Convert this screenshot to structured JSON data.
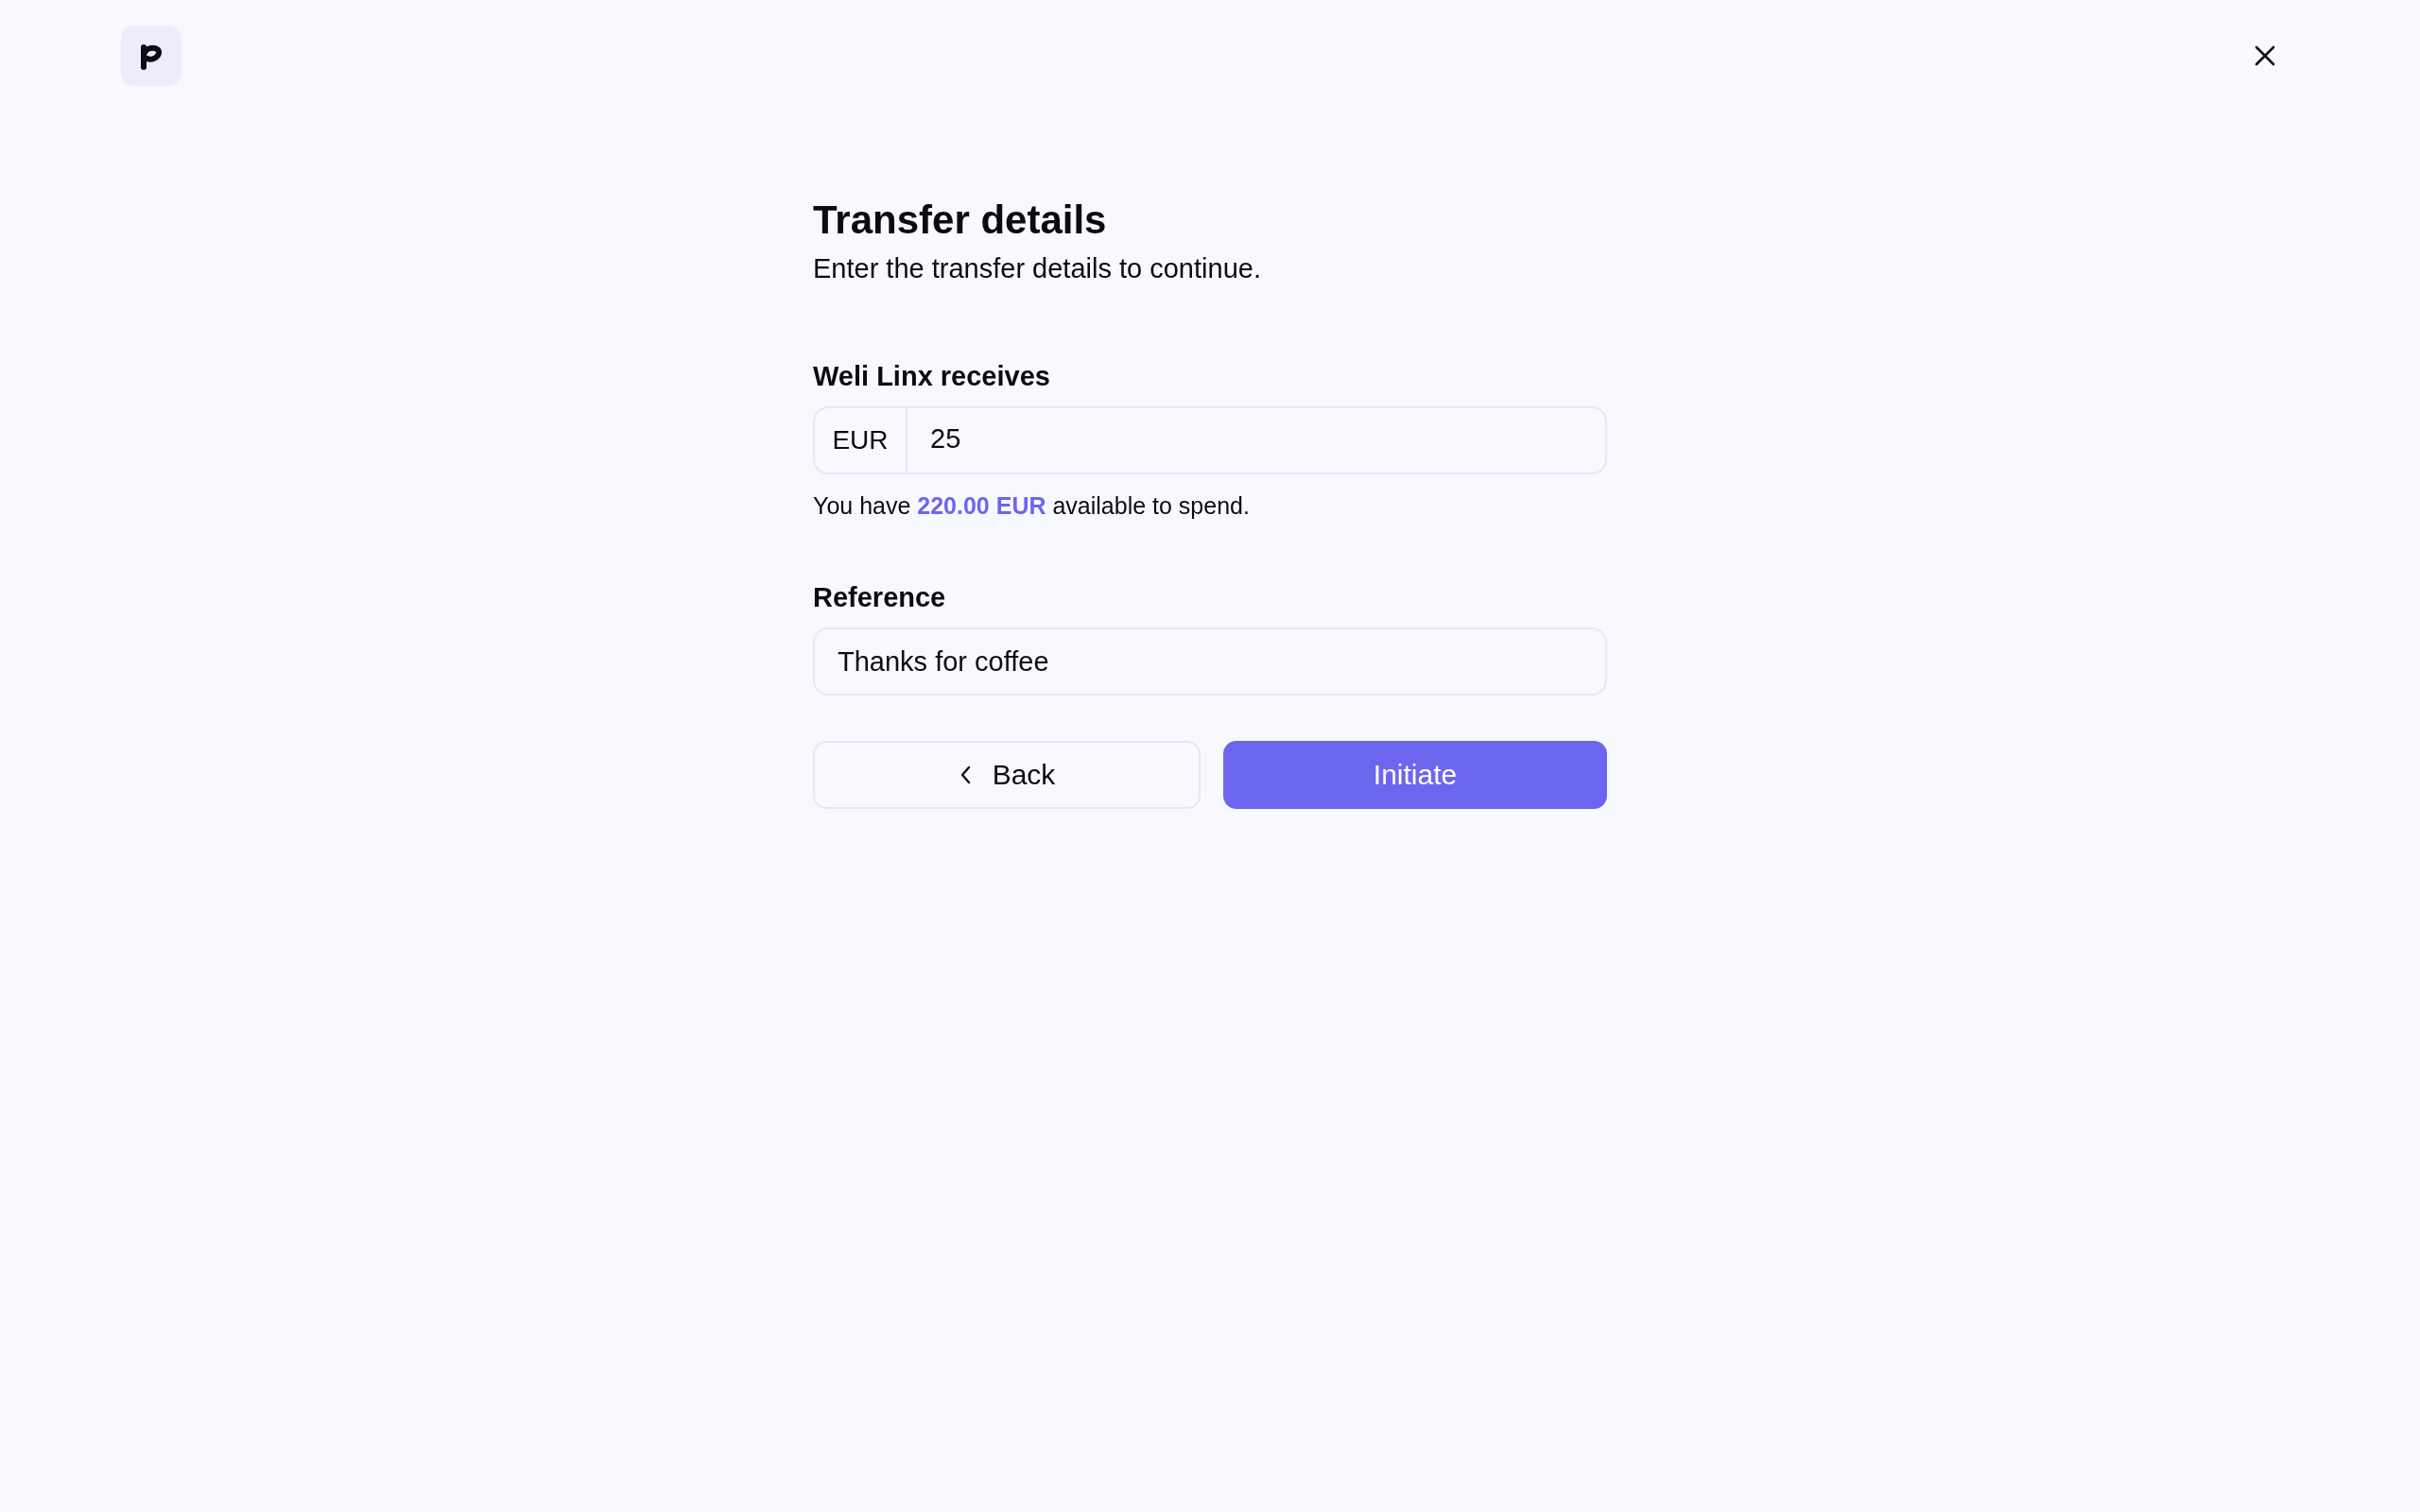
{
  "title": "Transfer details",
  "subtitle": "Enter the transfer details to continue.",
  "amount": {
    "label": "Weli Linx receives",
    "currency": "EUR",
    "value": "25"
  },
  "balance_note": "You have **220.00 EUR** available to spend.",
  "reference": {
    "label": "Reference",
    "value": "Thanks for coffee"
  },
  "buttons": [
    {
      "kind": "secondary",
      "label": "Back"
    },
    {
      "kind": "primary",
      "label": "Initiate"
    }
  ]
}
